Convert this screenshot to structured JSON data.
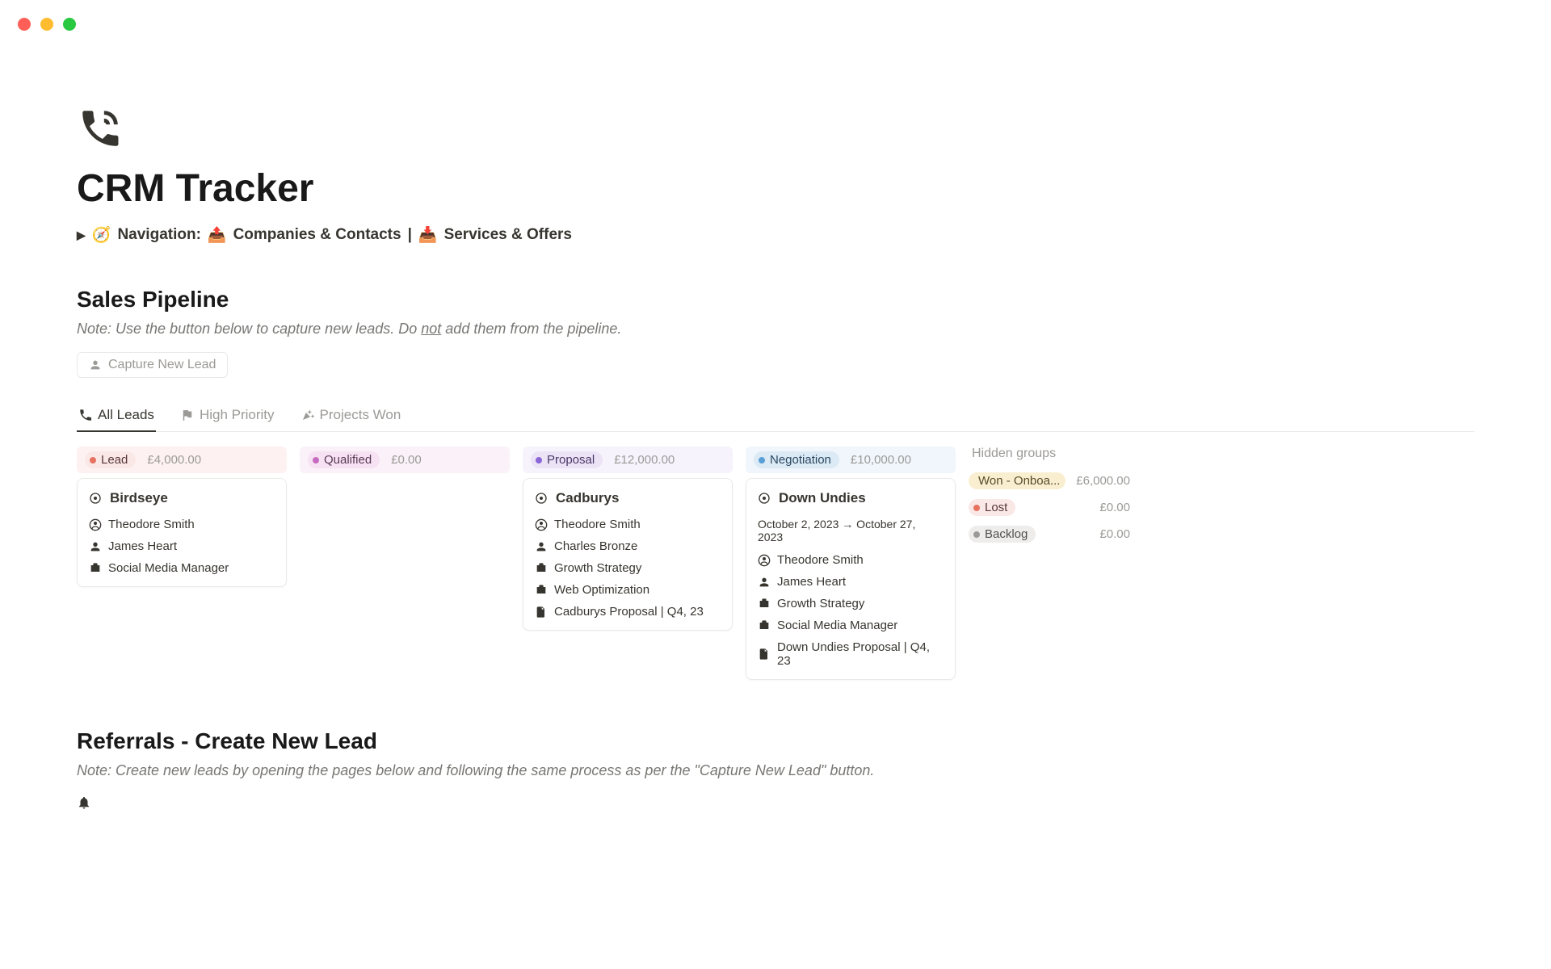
{
  "page": {
    "title": "CRM Tracker"
  },
  "nav": {
    "label": "Navigation:",
    "link1": "Companies & Contacts",
    "separator": "|",
    "link2": "Services & Offers"
  },
  "pipeline": {
    "title": "Sales Pipeline",
    "note_prefix": "Note: Use the button below to capture new leads. Do ",
    "note_underline": "not",
    "note_suffix": " add them from the pipeline.",
    "capture_button": "Capture New Lead"
  },
  "tabs": {
    "all_leads": "All Leads",
    "high_priority": "High Priority",
    "projects_won": "Projects Won"
  },
  "columns": {
    "lead": {
      "label": "Lead",
      "amount": "£4,000.00"
    },
    "qualified": {
      "label": "Qualified",
      "amount": "£0.00"
    },
    "proposal": {
      "label": "Proposal",
      "amount": "£12,000.00"
    },
    "negotiation": {
      "label": "Negotiation",
      "amount": "£10,000.00"
    }
  },
  "cards": {
    "birdseye": {
      "title": "Birdseye",
      "contact": "Theodore Smith",
      "owner": "James Heart",
      "service": "Social Media Manager"
    },
    "cadburys": {
      "title": "Cadburys",
      "contact1": "Theodore Smith",
      "contact2": "Charles Bronze",
      "service1": "Growth Strategy",
      "service2": "Web Optimization",
      "doc": "Cadburys Proposal | Q4, 23"
    },
    "down_undies": {
      "title": "Down Undies",
      "date": "October 2, 2023 → October 27, 2023",
      "contact": "Theodore Smith",
      "owner": "James Heart",
      "service1": "Growth Strategy",
      "service2": "Social Media Manager",
      "doc": "Down Undies Proposal | Q4, 23"
    }
  },
  "hidden": {
    "title": "Hidden groups",
    "won": {
      "label": "Won - Onboa...",
      "amount": "£6,000.00"
    },
    "lost": {
      "label": "Lost",
      "amount": "£0.00"
    },
    "backlog": {
      "label": "Backlog",
      "amount": "£0.00"
    }
  },
  "referrals": {
    "title": "Referrals - Create New Lead",
    "note": "Note: Create new leads by opening the pages below and following the same process as per the \"Capture New Lead\" button."
  }
}
